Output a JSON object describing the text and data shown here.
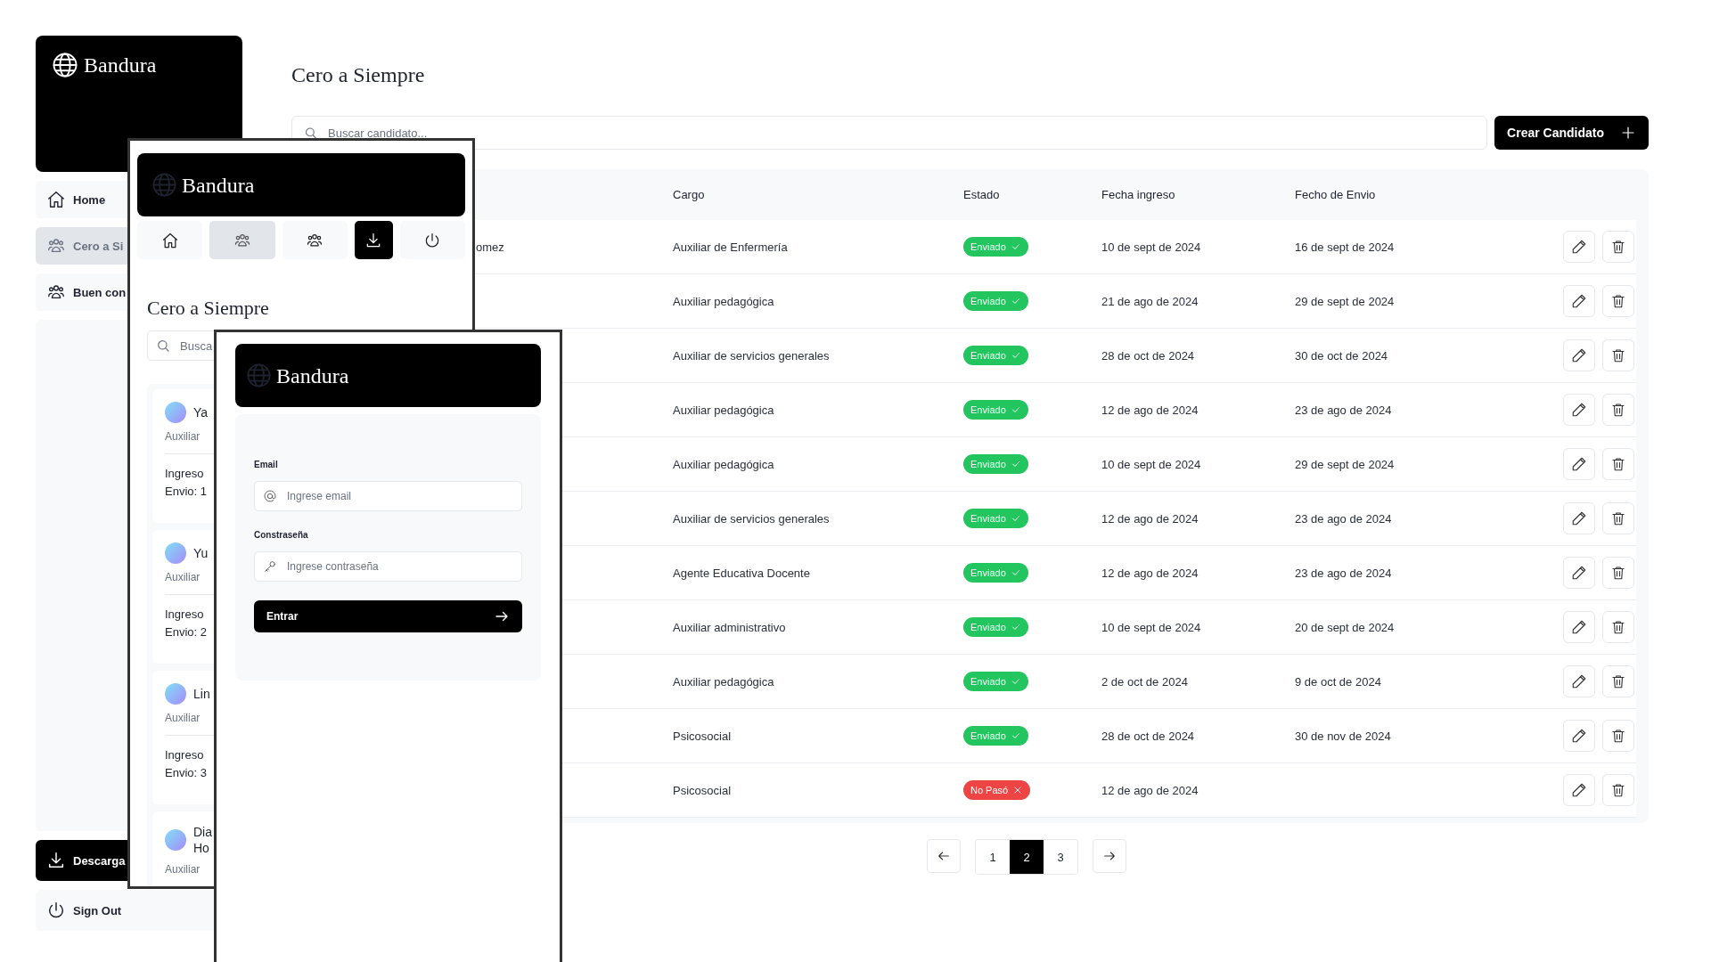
{
  "desktop": {
    "brand": "Bandura",
    "nav": [
      {
        "label": "Home",
        "selected": false
      },
      {
        "label": "Cero a Si",
        "selected": true
      },
      {
        "label": "Buen con",
        "selected": false
      }
    ],
    "download_button": "Descarga",
    "sign_out": "Sign Out",
    "title": "Cero a Siempre",
    "search": {
      "placeholder": "Buscar candidato..."
    },
    "create_button": "Crear Candidato",
    "table": {
      "columns": [
        "Cargo",
        "Estado",
        "Fecha ingreso",
        "Fecho de Envio"
      ],
      "rows": [
        {
          "name": "omez",
          "cargo": "Auxiliar de Enfermería",
          "status": {
            "label": "Enviado",
            "kind": "sent"
          },
          "fecha_ingreso": "10 de sept de 2024",
          "fecha_envio": "16 de sept de 2024"
        },
        {
          "cargo": "Auxiliar pedagógica",
          "status": {
            "label": "Enviado",
            "kind": "sent"
          },
          "fecha_ingreso": "21 de ago de 2024",
          "fecha_envio": "29 de sept de 2024"
        },
        {
          "cargo": "Auxiliar de servicios generales",
          "status": {
            "label": "Enviado",
            "kind": "sent"
          },
          "fecha_ingreso": "28 de oct de 2024",
          "fecha_envio": "30 de oct de 2024"
        },
        {
          "cargo": "Auxiliar pedagógica",
          "status": {
            "label": "Enviado",
            "kind": "sent"
          },
          "fecha_ingreso": "12 de ago de 2024",
          "fecha_envio": "23 de ago de 2024"
        },
        {
          "cargo": "Auxiliar pedagógica",
          "status": {
            "label": "Enviado",
            "kind": "sent"
          },
          "fecha_ingreso": "10 de sept de 2024",
          "fecha_envio": "29 de sept de 2024"
        },
        {
          "cargo": "Auxiliar de servicios generales",
          "status": {
            "label": "Enviado",
            "kind": "sent"
          },
          "fecha_ingreso": "12 de ago de 2024",
          "fecha_envio": "23 de ago de 2024"
        },
        {
          "cargo": "Agente Educativa Docente",
          "status": {
            "label": "Enviado",
            "kind": "sent"
          },
          "fecha_ingreso": "12 de ago de 2024",
          "fecha_envio": "23 de ago de 2024"
        },
        {
          "cargo": "Auxiliar administrativo",
          "status": {
            "label": "Enviado",
            "kind": "sent"
          },
          "fecha_ingreso": "10 de sept de 2024",
          "fecha_envio": "20 de sept de 2024"
        },
        {
          "cargo": "Auxiliar pedagógica",
          "status": {
            "label": "Enviado",
            "kind": "sent"
          },
          "fecha_ingreso": "2 de oct de 2024",
          "fecha_envio": "9 de oct de 2024"
        },
        {
          "cargo": "Psicosocial",
          "status": {
            "label": "Enviado",
            "kind": "sent"
          },
          "fecha_ingreso": "28 de oct de 2024",
          "fecha_envio": "30 de nov de 2024"
        },
        {
          "cargo": "Psicosocial",
          "status": {
            "label": "No Pasó",
            "kind": "failed"
          },
          "fecha_ingreso": "12 de ago de 2024"
        }
      ]
    },
    "pages": [
      {
        "label": "1",
        "selected": false
      },
      {
        "label": "2",
        "selected": true
      },
      {
        "label": "3",
        "selected": false
      }
    ]
  },
  "mobile": {
    "brand": "Bandura",
    "nav": [
      {
        "kind": "plain",
        "selected": false
      },
      {
        "kind": "plain",
        "selected": true
      },
      {
        "kind": "plain",
        "selected": false
      },
      {
        "kind": "primary",
        "selected": false
      },
      {
        "kind": "plain",
        "selected": false
      }
    ],
    "title": "Cero a Siempre",
    "search": {
      "placeholder": "Busca"
    },
    "cards": [
      {
        "name_lines": [
          "Ya"
        ],
        "role": "Auxiliar",
        "ingreso": "Ingreso",
        "envio": "Envio: 1"
      },
      {
        "name_lines": [
          "Yu"
        ],
        "role": "Auxiliar",
        "ingreso": "Ingreso",
        "envio": "Envio: 2"
      },
      {
        "name_lines": [
          "Lin"
        ],
        "role": "Auxiliar",
        "ingreso": "Ingreso",
        "envio": "Envio: 3"
      },
      {
        "name_lines": [
          "Dia",
          "Ho"
        ],
        "role": "Auxiliar"
      }
    ]
  },
  "login": {
    "brand": "Bandura",
    "email_label": "Email",
    "email_placeholder": "Ingrese email",
    "password_label": "Constraseña",
    "password_placeholder": "Ingrese contraseña",
    "submit": "Entrar"
  }
}
